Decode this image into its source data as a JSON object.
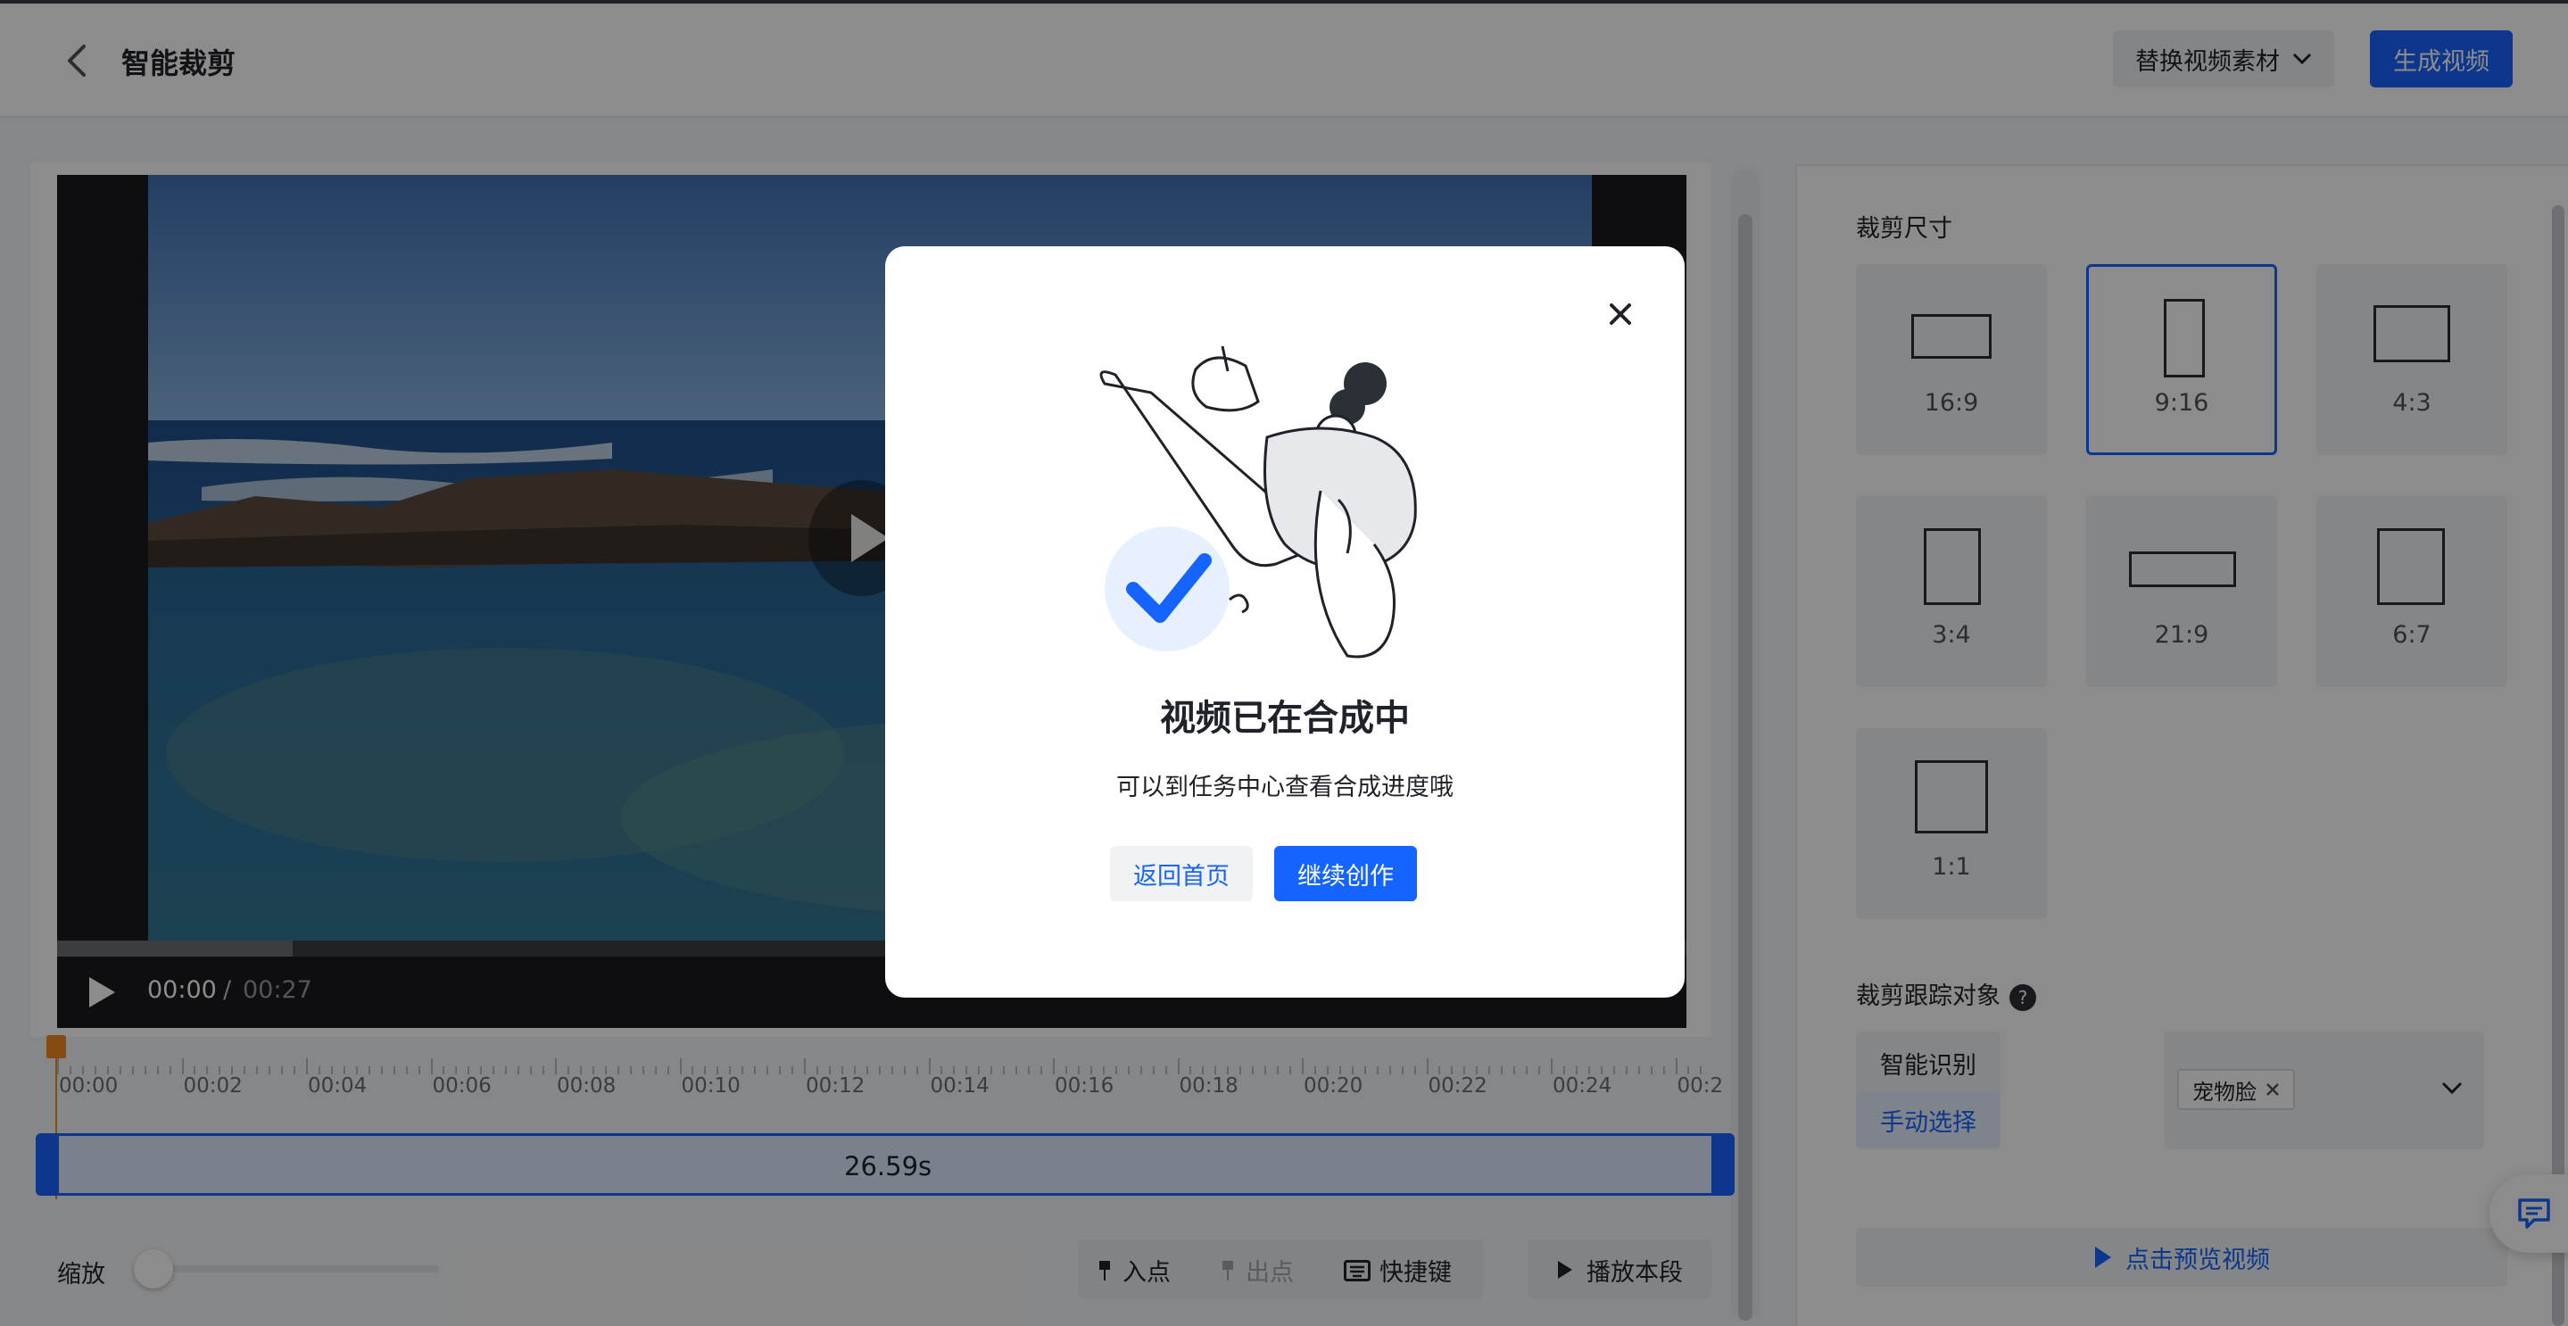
{
  "header": {
    "title": "智能裁剪",
    "replace_label": "替换视频素材",
    "generate_label": "生成视频"
  },
  "player": {
    "current_time": "00:00",
    "separator": "/",
    "total_time": "00:27"
  },
  "timeline": {
    "ticks": [
      "00:00",
      "00:02",
      "00:04",
      "00:06",
      "00:08",
      "00:10",
      "00:12",
      "00:14",
      "00:16",
      "00:18",
      "00:20",
      "00:22",
      "00:24",
      "00:2"
    ],
    "clip_duration": "26.59s"
  },
  "controls": {
    "zoom_label": "缩放",
    "in_point": "入点",
    "out_point": "出点",
    "shortcut": "快捷键",
    "play_segment": "播放本段"
  },
  "crop": {
    "section_title": "裁剪尺寸",
    "ratios": [
      "16:9",
      "9:16",
      "4:3",
      "3:4",
      "21:9",
      "6:7",
      "1:1"
    ],
    "selected": "9:16"
  },
  "tracking": {
    "section_title": "裁剪跟踪对象",
    "help": "?",
    "mode_auto": "智能识别",
    "mode_manual": "手动选择",
    "tag": "宠物脸"
  },
  "preview_button": "点击预览视频",
  "modal": {
    "title": "视频已在合成中",
    "subtitle": "可以到任务中心查看合成进度哦",
    "back_home": "返回首页",
    "continue": "继续创作"
  },
  "colors": {
    "primary": "#1664ff",
    "playhead": "#f08a24"
  }
}
